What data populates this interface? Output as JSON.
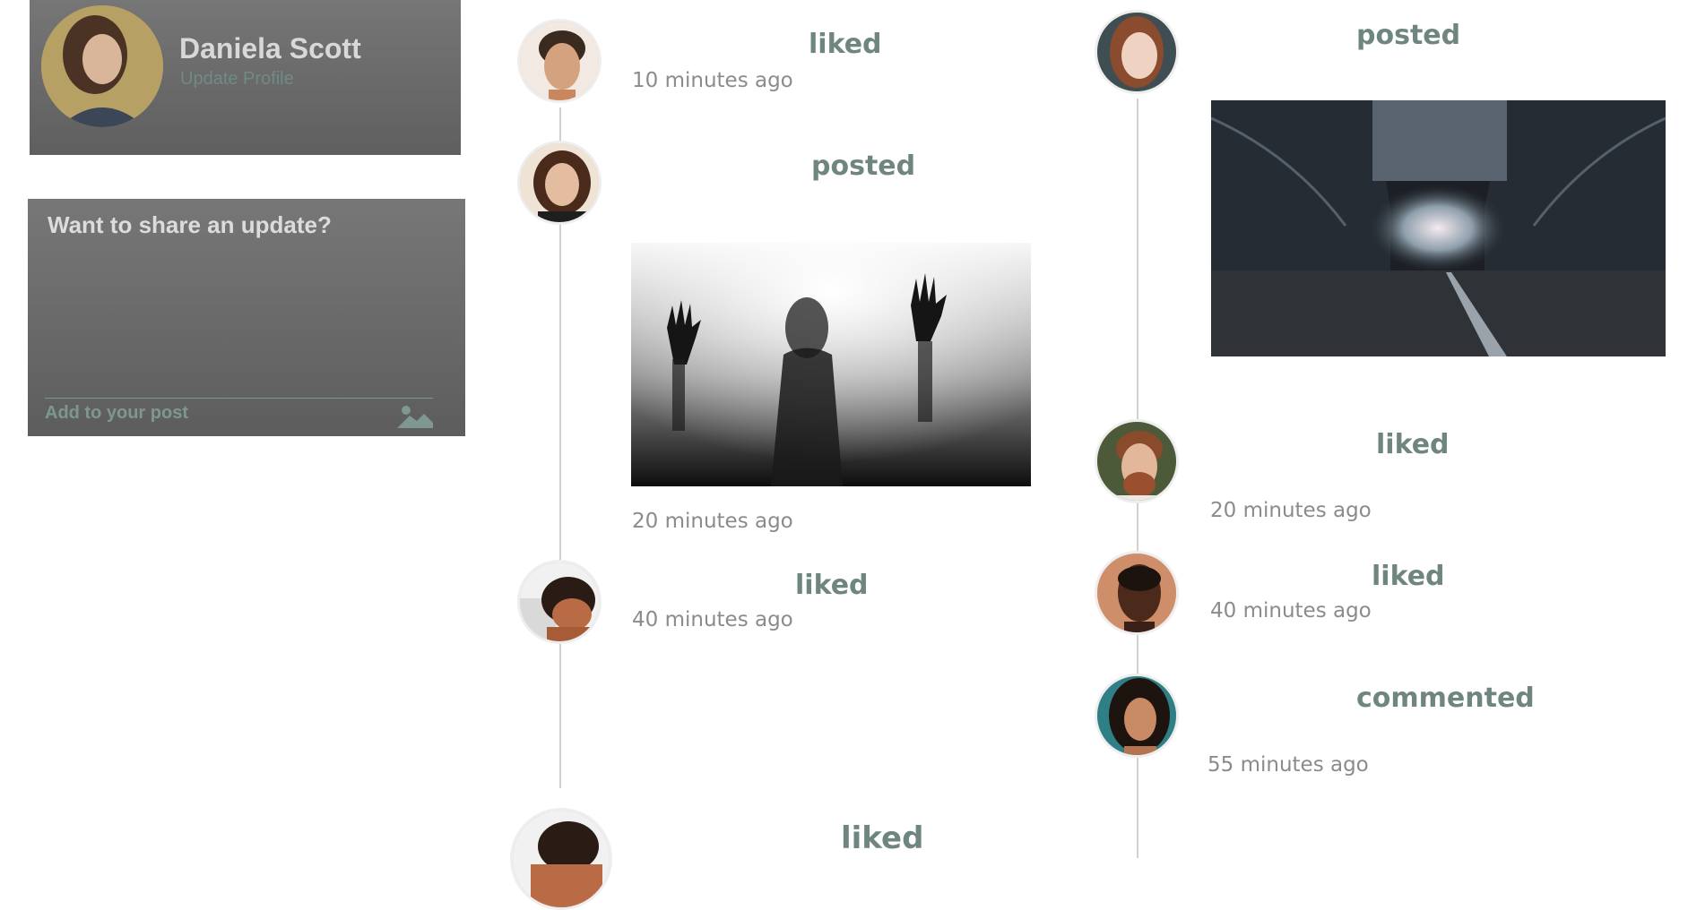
{
  "profile": {
    "name": "Daniela Scott",
    "update_link": "Update Profile"
  },
  "composer": {
    "placeholder": "Want to share an update?",
    "add_label": "Add to your post",
    "icon": "image-icon"
  },
  "feed_left": [
    {
      "action": "liked",
      "time": "10 minutes ago"
    },
    {
      "action": "posted",
      "time": "20 minutes ago",
      "image": "silhouette-behind-sheet"
    },
    {
      "action": "liked",
      "time": "40 minutes ago"
    },
    {
      "action": "liked",
      "time": ""
    }
  ],
  "feed_right": [
    {
      "action": "posted",
      "time": "",
      "image": "dark-tarp-tunnel"
    },
    {
      "action": "liked",
      "time": "20 minutes ago"
    },
    {
      "action": "liked",
      "time": "40 minutes ago"
    },
    {
      "action": "commented",
      "time": "55 minutes ago"
    }
  ],
  "colors": {
    "panel": "#6b6b6b",
    "accent_text": "#6f8680",
    "muted_text": "#8b8b8b",
    "timeline": "#d0d0d0"
  }
}
